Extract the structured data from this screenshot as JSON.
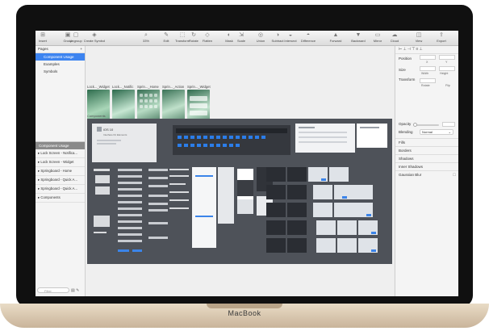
{
  "device": {
    "brand": "MacBook"
  },
  "colors": {
    "selection": "#3d84f0",
    "dark_canvas": "#4e5259",
    "bezel": "#101010",
    "base": "#d9c8ad"
  },
  "toolbar": {
    "items": [
      {
        "label": "Insert",
        "icon": "plus-square-icon"
      },
      {
        "label": "Group",
        "icon": "group-icon"
      },
      {
        "label": "Ungroup",
        "icon": "ungroup-icon"
      },
      {
        "label": "Create Symbol",
        "icon": "symbol-icon"
      },
      {
        "label": "33%",
        "icon": "zoom-icon"
      },
      {
        "label": "Edit",
        "icon": "edit-icon"
      },
      {
        "label": "Transform",
        "icon": "transform-icon"
      },
      {
        "label": "Rotate",
        "icon": "rotate-icon"
      },
      {
        "label": "Flatten",
        "icon": "flatten-icon"
      },
      {
        "label": "Mask",
        "icon": "mask-icon"
      },
      {
        "label": "Scale",
        "icon": "scale-icon"
      },
      {
        "label": "Union",
        "icon": "union-icon"
      },
      {
        "label": "Subtract",
        "icon": "subtract-icon"
      },
      {
        "label": "Intersect",
        "icon": "intersect-icon"
      },
      {
        "label": "Difference",
        "icon": "difference-icon"
      },
      {
        "label": "Forward",
        "icon": "forward-icon"
      },
      {
        "label": "Backward",
        "icon": "backward-icon"
      },
      {
        "label": "Mirror",
        "icon": "mirror-icon"
      },
      {
        "label": "Cloud",
        "icon": "cloud-icon"
      },
      {
        "label": "View",
        "icon": "view-icon"
      },
      {
        "label": "Export",
        "icon": "export-icon"
      }
    ]
  },
  "pages": {
    "header": "Pages",
    "add": "+",
    "items": [
      {
        "label": "Component Usage",
        "selected": true
      },
      {
        "label": "Examples",
        "selected": false
      },
      {
        "label": "Symbols",
        "selected": false
      }
    ]
  },
  "layers": {
    "selected": "Component Usage",
    "items": [
      {
        "label": "Lock Screen - Notifica..."
      },
      {
        "label": "Lock Screen - Widget"
      },
      {
        "label": "Springboard - Home"
      },
      {
        "label": "Springboard - Quick A..."
      },
      {
        "label": "Springboard - Quick A..."
      },
      {
        "label": "Components"
      }
    ],
    "filter_placeholder": "Filter"
  },
  "canvas": {
    "artboards": [
      {
        "label": "Lock..._Widget"
      },
      {
        "label": "Lock..._Notific"
      },
      {
        "label": "Sprin..._Home"
      },
      {
        "label": "Sprin..._Action"
      },
      {
        "label": "Sprin..._Widget"
      }
    ],
    "components_label": "Components",
    "kit_title": "iOS 10",
    "kit_subtitle": "Interface Kit Elements"
  },
  "inspector": {
    "position": "Position",
    "x": "X",
    "y": "Y",
    "size": "Size",
    "width": "Width",
    "height": "Height",
    "transform": "Transform",
    "rotate": "Rotate",
    "flip": "Flip",
    "opacity": "Opacity",
    "blending": "Blending",
    "blending_value": "Normal",
    "sections": [
      {
        "label": "Fills"
      },
      {
        "label": "Borders"
      },
      {
        "label": "Shadows"
      },
      {
        "label": "Inner Shadows"
      },
      {
        "label": "Gaussian Blur"
      }
    ]
  }
}
